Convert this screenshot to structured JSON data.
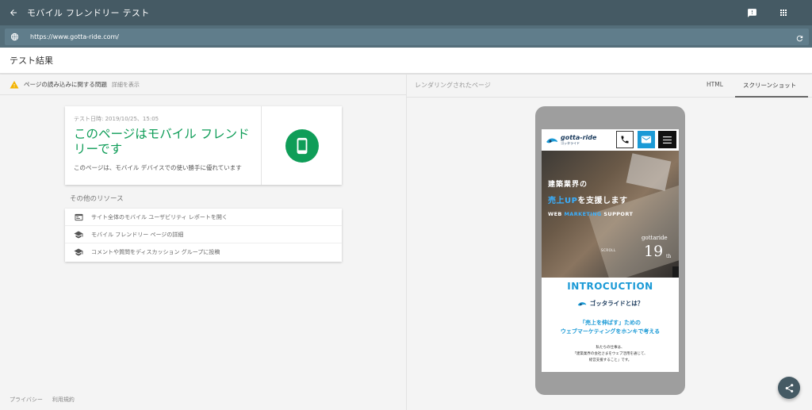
{
  "app": {
    "title": "モバイル フレンドリー テスト",
    "url": "https://www.gotta-ride.com/",
    "section_title": "テスト結果"
  },
  "issues": {
    "text": "ページの読み込みに関する問題",
    "detail_link": "詳細を表示",
    "warn_color": "#f4b400"
  },
  "result": {
    "date": "テスト日時: 2019/10/25、15:05",
    "headline": "このページはモバイル フレンドリーです",
    "description": "このページは、モバイル デバイスでの使い勝手に優れています",
    "accent_color": "#0f9d58",
    "icon": "smartphone-icon"
  },
  "other_resources": {
    "title": "その他のリソース",
    "items": [
      {
        "icon": "report-icon",
        "label": "サイト全体のモバイル ユーザビリティ レポートを開く"
      },
      {
        "icon": "school-icon",
        "label": "モバイル フレンドリー ページの詳細"
      },
      {
        "icon": "school-icon",
        "label": "コメントや質問をディスカッション グループに投稿"
      }
    ]
  },
  "footer": {
    "privacy": "プライバシー",
    "terms": "利用規約"
  },
  "render_panel": {
    "label": "レンダリングされたページ",
    "tabs": [
      {
        "label": "HTML",
        "active": false
      },
      {
        "label": "スクリーンショット",
        "active": true
      }
    ]
  },
  "site_preview": {
    "logo_name": "gotta-ride",
    "logo_sub": "ゴッタライド",
    "hero_line1": "建築業界の",
    "hero_line2_highlight": "売上UP",
    "hero_line2_rest": "を支援します",
    "hero_line3_a": "WEB ",
    "hero_line3_highlight": "MARKETING",
    "hero_line3_b": " SUPPORT",
    "scroll": "SCROLL",
    "anniv_label": "gottaride",
    "anniv_number": "19",
    "anniv_suffix": "th",
    "intro_title": "INTROCUCTION",
    "intro_what": "ゴッタライドとは？",
    "lead1": "「売上を伸ばす」ための",
    "lead2": "ウェブマーケティングをホンキで考える",
    "body1": "私たちの仕事は、",
    "body2": "「建築業界の会社さまをウェブ活用を通じて、",
    "body3": "経営支援すること」です。",
    "brand_color": "#1b9ad6"
  },
  "colors": {
    "appbar": "#455a64",
    "urlbar": "#546e7a"
  }
}
